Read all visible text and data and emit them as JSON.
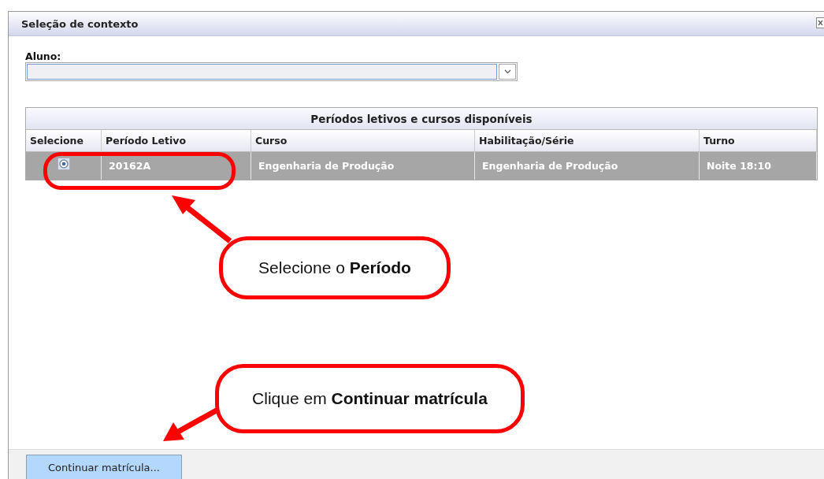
{
  "window": {
    "title": "Seleção de contexto"
  },
  "student_field": {
    "label": "Aluno:"
  },
  "table": {
    "title": "Períodos letivos e cursos disponíveis",
    "columns": [
      "Selecione",
      "Período Letivo",
      "Curso",
      "Habilitação/Série",
      "Turno"
    ],
    "rows": [
      {
        "selected": true,
        "radio_checked": true,
        "cells": [
          "",
          "20162A",
          "Engenharia de Produção",
          "Engenharia de Produção",
          "Noite 18:10"
        ]
      }
    ]
  },
  "annotations": [
    {
      "text": "Selecione o **Período**"
    },
    {
      "text": "Clique em **Continuar matrícula**"
    }
  ],
  "buttons": [
    {
      "label": "Continuar matrícula..."
    }
  ]
}
